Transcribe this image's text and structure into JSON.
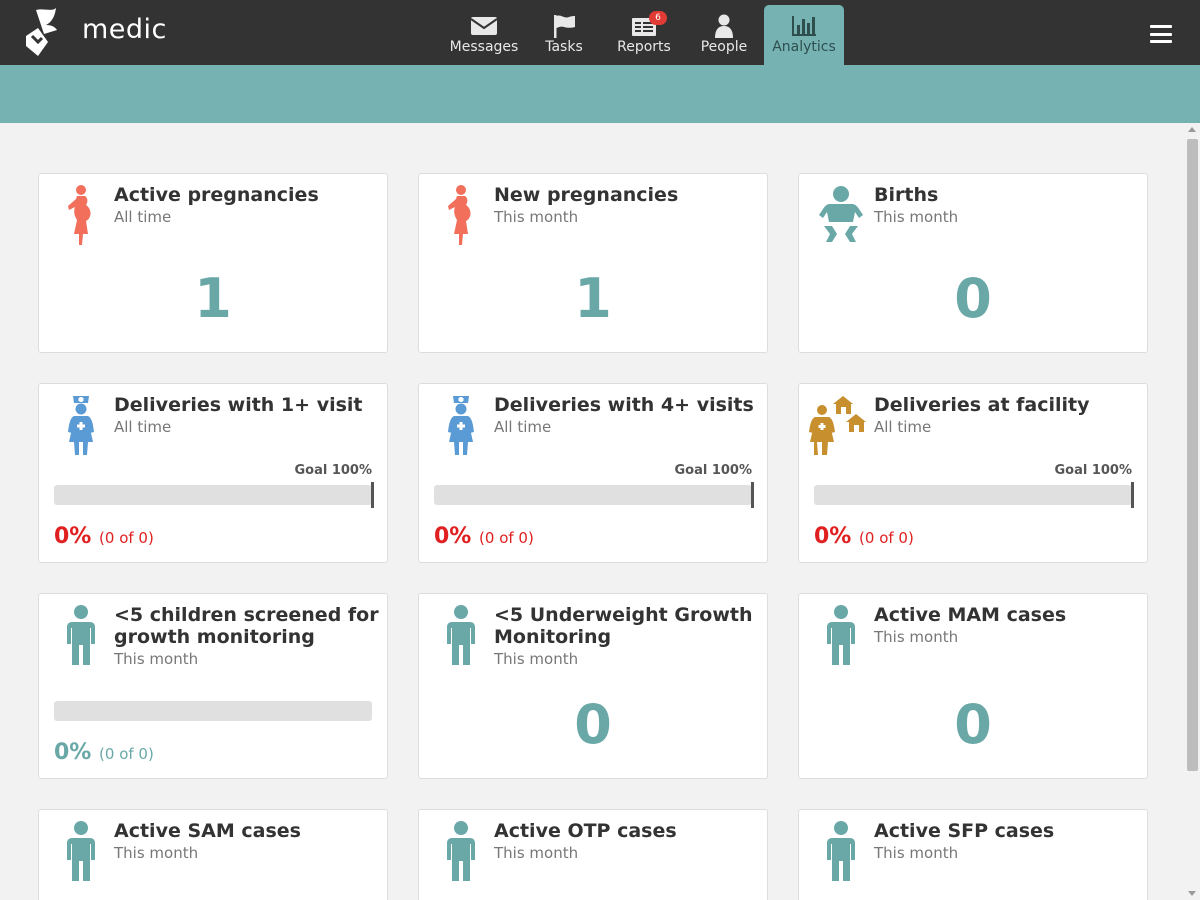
{
  "app": {
    "logo_text": "medic"
  },
  "nav": {
    "tabs": [
      {
        "label": "Messages",
        "icon": "envelope-icon",
        "active": false
      },
      {
        "label": "Tasks",
        "icon": "flag-icon",
        "active": false
      },
      {
        "label": "Reports",
        "icon": "reports-icon",
        "active": false,
        "badge": "6"
      },
      {
        "label": "People",
        "icon": "person-icon",
        "active": false
      },
      {
        "label": "Analytics",
        "icon": "bar-chart-icon",
        "active": true
      }
    ]
  },
  "colors": {
    "topbar": "#333333",
    "accent_teal": "#76b2b2",
    "value_teal": "#6aa8a8",
    "danger_red": "#e02020",
    "pregnancy_coral": "#f26f5b",
    "nurse_blue": "#5b9bd5",
    "facility_gold": "#c78f2e",
    "child_teal": "#6aa8a8"
  },
  "cards": [
    {
      "title": "Active pregnancies",
      "subtitle": "All time",
      "value": "1",
      "icon": "pregnant-woman-icon"
    },
    {
      "title": "New pregnancies",
      "subtitle": "This month",
      "value": "1",
      "icon": "pregnant-woman-icon"
    },
    {
      "title": "Births",
      "subtitle": "This month",
      "value": "0",
      "icon": "baby-icon"
    },
    {
      "title": "Deliveries with 1+ visit",
      "subtitle": "All time",
      "goal": "Goal 100%",
      "percent": "0%",
      "detail": "(0 of 0)",
      "progress": 0,
      "icon": "nurse-icon"
    },
    {
      "title": "Deliveries with 4+ visits",
      "subtitle": "All time",
      "goal": "Goal 100%",
      "percent": "0%",
      "detail": "(0 of 0)",
      "progress": 0,
      "icon": "nurse-icon"
    },
    {
      "title": "Deliveries at facility",
      "subtitle": "All time",
      "goal": "Goal 100%",
      "percent": "0%",
      "detail": "(0 of 0)",
      "progress": 0,
      "icon": "facility-delivery-icon"
    },
    {
      "title": "<5 children screened for growth monitoring",
      "subtitle": "This month",
      "percent": "0%",
      "detail": "(0 of 0)",
      "progress": 0,
      "icon": "child-icon"
    },
    {
      "title": "<5 Underweight Growth Monitoring",
      "subtitle": "This month",
      "value": "0",
      "icon": "child-icon"
    },
    {
      "title": "Active MAM cases",
      "subtitle": "This month",
      "value": "0",
      "icon": "child-icon"
    },
    {
      "title": "Active SAM cases",
      "subtitle": "This month",
      "icon": "child-icon"
    },
    {
      "title": "Active OTP cases",
      "subtitle": "This month",
      "icon": "child-icon"
    },
    {
      "title": "Active SFP cases",
      "subtitle": "This month",
      "icon": "child-icon"
    }
  ]
}
